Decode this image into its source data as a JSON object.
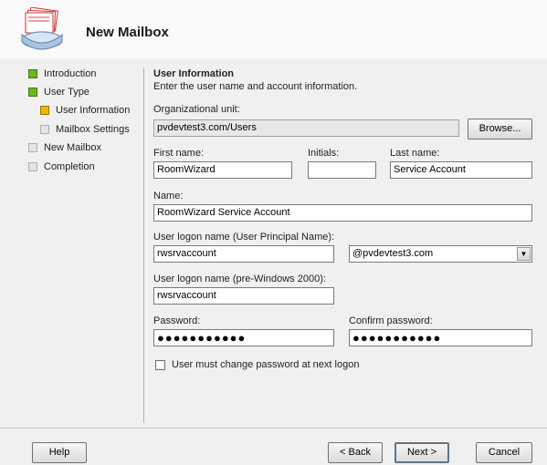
{
  "header": {
    "title": "New Mailbox"
  },
  "sidebar": {
    "items": [
      {
        "label": "Introduction",
        "status": "green"
      },
      {
        "label": "User Type",
        "status": "green"
      },
      {
        "label": "User Information",
        "status": "yellow"
      },
      {
        "label": "Mailbox Settings",
        "status": "gray"
      },
      {
        "label": "New Mailbox",
        "status": "gray"
      },
      {
        "label": "Completion",
        "status": "gray"
      }
    ]
  },
  "section": {
    "title": "User Information",
    "description": "Enter the user name and account information."
  },
  "form": {
    "org_unit": {
      "label": "Organizational unit:",
      "value": "pvdevtest3.com/Users",
      "browse_label": "Browse..."
    },
    "first_name": {
      "label": "First name:",
      "value": "RoomWizard"
    },
    "initials": {
      "label": "Initials:",
      "value": ""
    },
    "last_name": {
      "label": "Last name:",
      "value": "Service Account"
    },
    "name": {
      "label": "Name:",
      "value": "RoomWizard Service Account"
    },
    "upn": {
      "label": "User logon name (User Principal Name):",
      "value": "rwsrvaccount",
      "domain": "@pvdevtest3.com"
    },
    "pre2000": {
      "label": "User logon name (pre-Windows 2000):",
      "value": "rwsrvaccount"
    },
    "password": {
      "label": "Password:",
      "value": "●●●●●●●●●●●"
    },
    "confirm_password": {
      "label": "Confirm password:",
      "value": "●●●●●●●●●●●"
    },
    "must_change": {
      "label": "User must change password at next logon",
      "checked": false
    }
  },
  "footer": {
    "help": "Help",
    "back": "< Back",
    "next": "Next >",
    "cancel": "Cancel"
  },
  "colors": {
    "status_green": "#6fb520",
    "status_yellow": "#f0b800",
    "status_gray": "#e4e4e4"
  }
}
